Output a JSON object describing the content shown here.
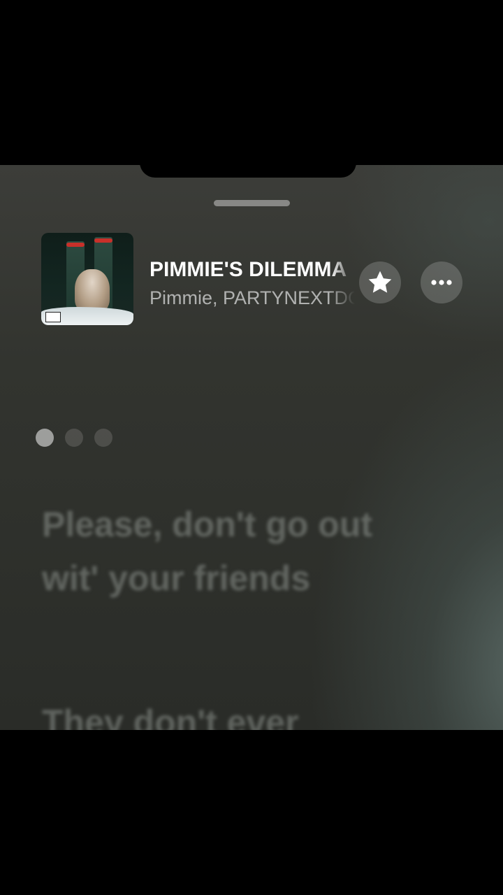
{
  "now_playing": {
    "title": "PIMMIE'S DILEMMA",
    "artists": "Pimmie, PARTYNEXTDOOR"
  },
  "actions": {
    "favorite_icon": "star-icon",
    "more_icon": "ellipsis-icon"
  },
  "page_indicator": {
    "count": 3,
    "active_index": 0
  },
  "lyrics": {
    "current_line": "Please, don't go out wit' your friends",
    "next_line": "They don't ever"
  },
  "colors": {
    "background": "#32342f",
    "title": "#ffffff",
    "lyric_dimmed": "#8c918c"
  }
}
